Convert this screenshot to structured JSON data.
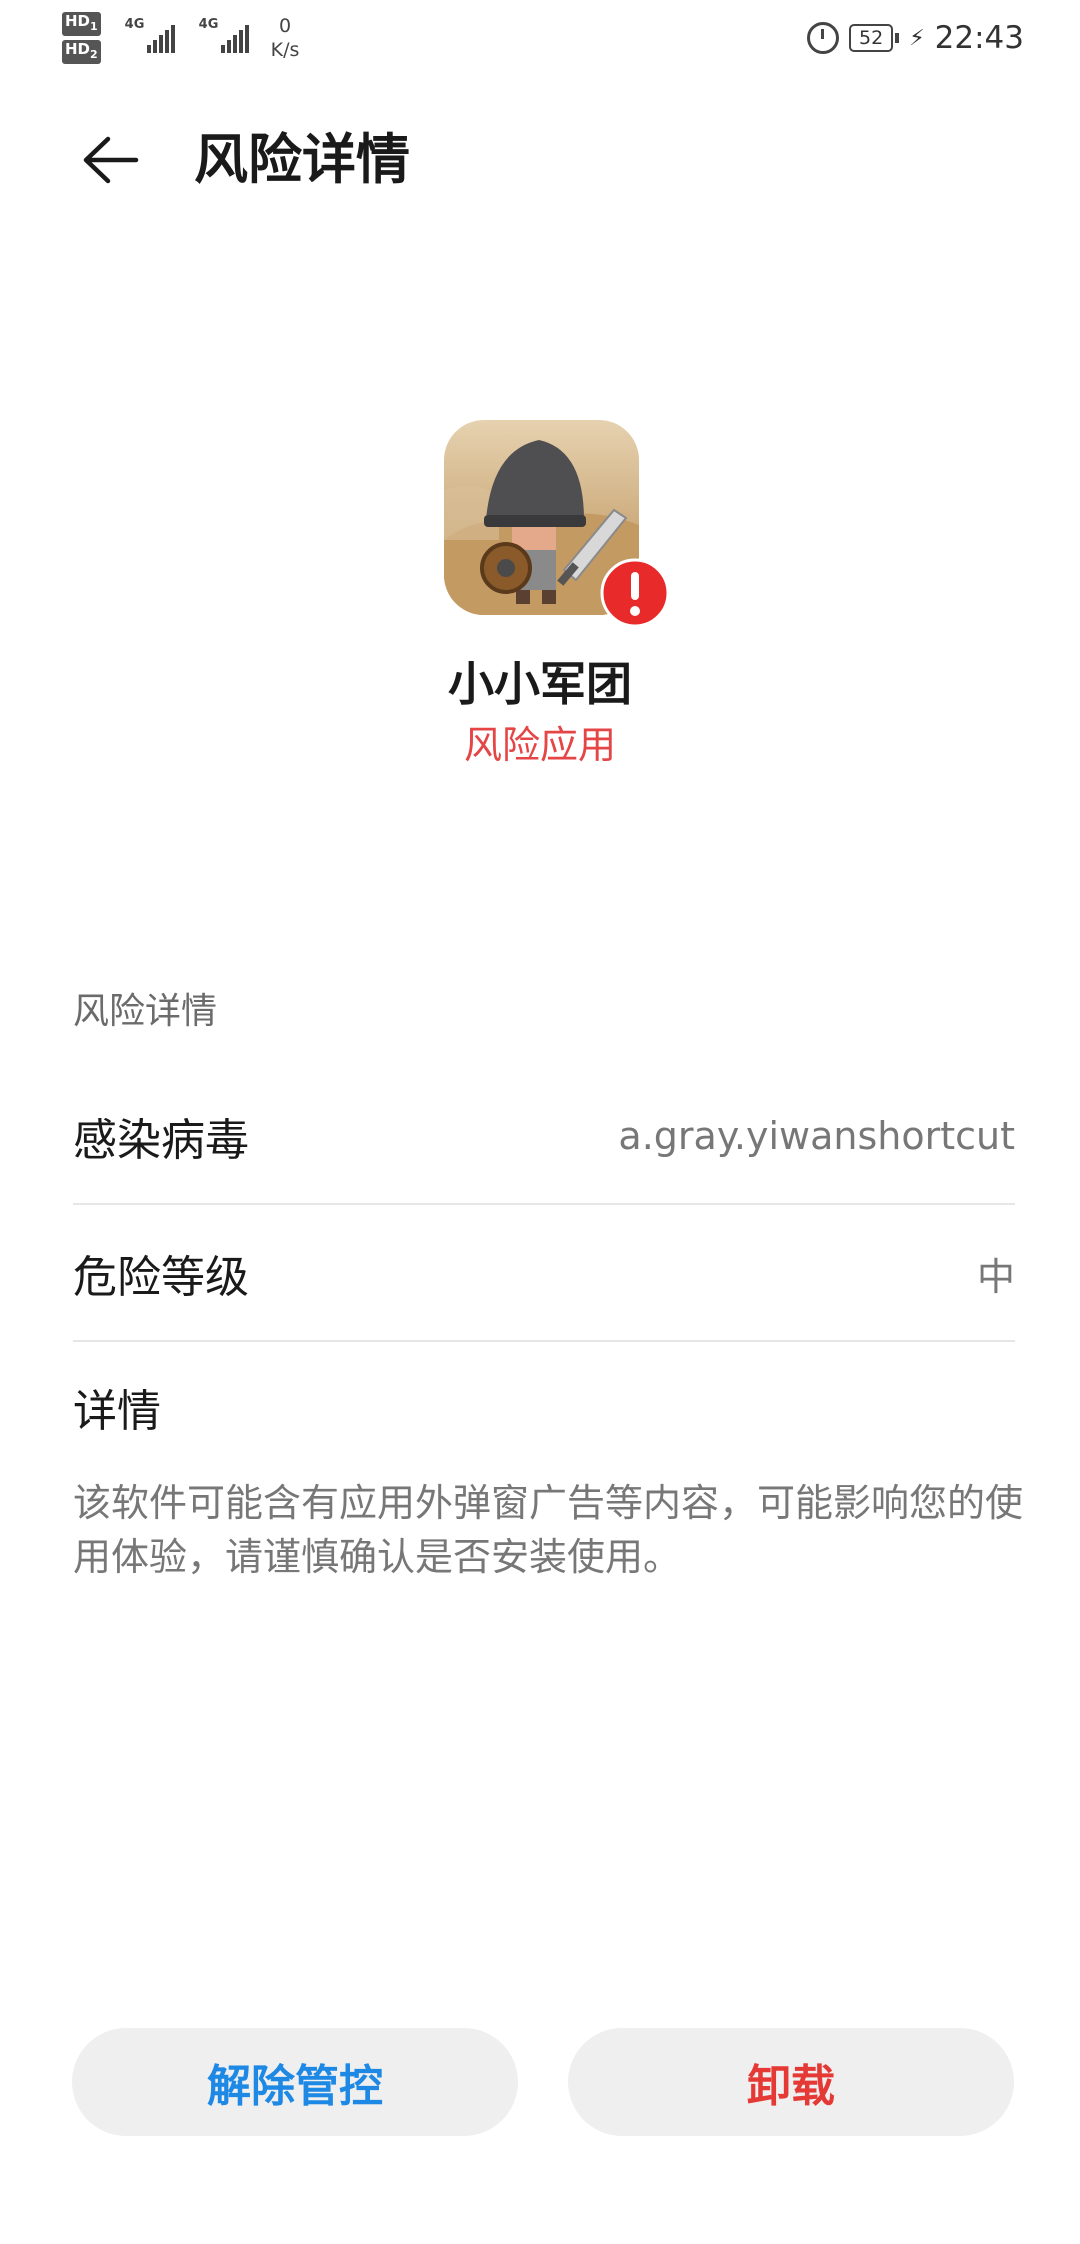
{
  "status_bar": {
    "hd1": "HD",
    "hd1_sub": "1",
    "hd2": "HD",
    "hd2_sub": "2",
    "net1": "4G",
    "net2": "4G",
    "speed_value": "0",
    "speed_unit": "K/s",
    "battery": "52",
    "time": "22:43",
    "icons": [
      "alarm-icon",
      "battery-icon",
      "charging-icon",
      "signal-icon"
    ]
  },
  "header": {
    "title": "风险详情",
    "back_icon": "arrow-left-icon"
  },
  "app": {
    "name": "小小军团",
    "status": "风险应用",
    "status_color": "#e64545",
    "badge_icon": "exclamation-icon"
  },
  "section": {
    "title": "风险详情",
    "rows": [
      {
        "label": "感染病毒",
        "value": "a.gray.yiwanshortcut"
      },
      {
        "label": "危险等级",
        "value": "中"
      }
    ],
    "detail_title": "详情",
    "detail_text": "该软件可能含有应用外弹窗广告等内容，可能影响您的使用体验，请谨慎确认是否安装使用。"
  },
  "actions": {
    "release_label": "解除管控",
    "release_color": "#1e88e5",
    "uninstall_label": "卸载",
    "uninstall_color": "#e53935"
  }
}
